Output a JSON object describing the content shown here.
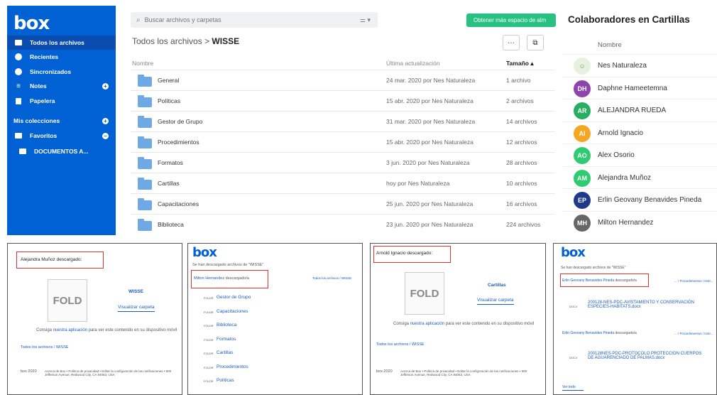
{
  "sidebar": {
    "logo": "box",
    "items": [
      {
        "label": "Todos los archivos",
        "active": true
      },
      {
        "label": "Recientes"
      },
      {
        "label": "Sincronizados"
      },
      {
        "label": "Notes"
      },
      {
        "label": "Papelera"
      }
    ],
    "collections_label": "Mis colecciones",
    "favorites_label": "Favoritos",
    "docs_label": "DOCUMENTOS A..."
  },
  "search": {
    "placeholder": "Buscar archivos y carpetas"
  },
  "upgrade_label": "Obtener más espacio de alm",
  "breadcrumb": {
    "root": "Todos los archivos",
    "sep": ">",
    "current": "WISSE"
  },
  "toolbar": {
    "more_label": "···",
    "view_label": "⧉"
  },
  "table": {
    "headers": {
      "name": "Nombre",
      "updated": "Última actualización",
      "size": "Tamaño ▴"
    },
    "rows": [
      {
        "name": "General",
        "updated": "24 mar. 2020 por Nes Naturaleza",
        "size": "1 archivo"
      },
      {
        "name": "Políticas",
        "updated": "15 abr. 2020 por Nes Naturaleza",
        "size": "2 archivos"
      },
      {
        "name": "Gestor de Grupo",
        "updated": "31 mar. 2020 por Nes Naturaleza",
        "size": "14 archivos"
      },
      {
        "name": "Procedimientos",
        "updated": "15 abr. 2020 por Nes Naturaleza",
        "size": "12 archivos"
      },
      {
        "name": "Formatos",
        "updated": "3 jun. 2020 por Nes Naturaleza",
        "size": "28 archivos"
      },
      {
        "name": "Cartillas",
        "updated": "hoy por Nes Naturaleza",
        "size": "10 archivos"
      },
      {
        "name": "Capacitaciones",
        "updated": "25 jun. 2020 por Nes Naturaleza",
        "size": "16 archivos"
      },
      {
        "name": "Biblioteca",
        "updated": "23 jun. 2020 por Nes Naturaleza",
        "size": "224 archivos"
      }
    ]
  },
  "collab": {
    "title": "Colaboradores en Cartillas",
    "name_header": "Nombre",
    "people": [
      {
        "initials": "",
        "name": "Nes Naturaleza",
        "color": "#e8f0e0"
      },
      {
        "initials": "DH",
        "name": "Daphne Hameetemna",
        "color": "#8e44ad"
      },
      {
        "initials": "AR",
        "name": "ALEJANDRA RUEDA",
        "color": "#27ae60"
      },
      {
        "initials": "AI",
        "name": "Arnold Ignacio",
        "color": "#f5a623"
      },
      {
        "initials": "AO",
        "name": "Alex Osorio",
        "color": "#2ecc71"
      },
      {
        "initials": "AM",
        "name": "Alejandra Muñoz",
        "color": "#2ecc71"
      },
      {
        "initials": "EP",
        "name": "Erlin Geovany Benavides Pineda",
        "color": "#1f3a8a"
      },
      {
        "initials": "MH",
        "name": "Milton Hernandez",
        "color": "#666666"
      }
    ]
  },
  "panel1": {
    "header": "Alejandra Muñoz descargado:",
    "fold": "FOLD",
    "folder": "WISSE",
    "view": "Visualizar carpeta",
    "promo_a": "Consiga",
    "promo_link": "nuestra aplicación",
    "promo_b": "para ver este contenido en su dispositivo móvil",
    "path": "Todos los archivos / WISSE",
    "footer_logo": "box 2020",
    "footer_text": "Acerca de Box • Política de privacidad • Editar la configuración de las notificaciones • 900 Jefferson Avenue, Redwood City, CA 94063, USA"
  },
  "panel2": {
    "logo": "box",
    "intro": "Se han descargado archivos de \"WISSE\"",
    "user": "Milton Hernandez",
    "user_suffix": "descargado/a",
    "path": "Todos los archivos / WISSE",
    "folders": [
      "Gestor de Grupo",
      "Capacitaciones",
      "Biblioteca",
      "Formatos",
      "Cartillas",
      "Procedimientos",
      "Políticas"
    ]
  },
  "panel3": {
    "header": "Arnold Ignacio descargado:",
    "fold": "FOLD",
    "folder": "Cartillas",
    "view": "Visualizar carpeta",
    "promo_a": "Consiga",
    "promo_link": "nuestra aplicación",
    "promo_b": "para ver este contenido en su dispositivo móvil",
    "path": "Todos los archivos / WISSE",
    "footer_logo": "box 2020",
    "footer_text": "Acerca de Box • Política de privacidad • Editar la configuración de las notificaciones • 900 Jefferson Avenue, Redwood City, CA 94063, USA"
  },
  "panel4": {
    "logo": "box",
    "intro": "Se han descargado archivos de \"WISSE\"",
    "user": "Erlin Geovany Benavides Pineda",
    "user_suffix": "descargado/a",
    "path1": "... / Procedimientos / Instr...",
    "file1": "200128-NES-PDC-AVISTAMIENTO Y CONSERVACIÓN ESPECIES-HABITATS.docx",
    "user2": "Erlin Geovany Benavides Pineda",
    "user2_suffix": "descargado/a",
    "path2": "... / Procedimientos / Instr...",
    "file2": "200128NES-PDC-PROTOCOLO PROTECCION CUERPOS DE AGUARENCIADO DE PALMAS.docx",
    "see_all": "Ver todo"
  }
}
